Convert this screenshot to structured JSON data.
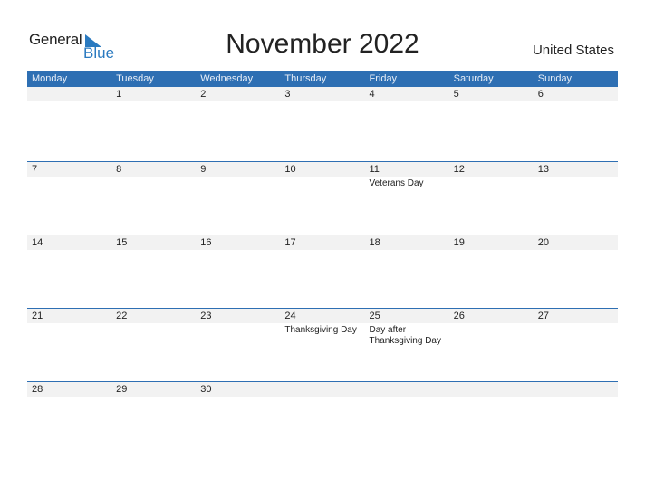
{
  "logo": {
    "general": "General",
    "blue": "Blue"
  },
  "title": "November 2022",
  "country": "United States",
  "weekdays": [
    "Monday",
    "Tuesday",
    "Wednesday",
    "Thursday",
    "Friday",
    "Saturday",
    "Sunday"
  ],
  "weeks": [
    {
      "days": [
        "",
        "1",
        "2",
        "3",
        "4",
        "5",
        "6"
      ],
      "events": [
        "",
        "",
        "",
        "",
        "",
        "",
        ""
      ]
    },
    {
      "days": [
        "7",
        "8",
        "9",
        "10",
        "11",
        "12",
        "13"
      ],
      "events": [
        "",
        "",
        "",
        "",
        "Veterans Day",
        "",
        ""
      ]
    },
    {
      "days": [
        "14",
        "15",
        "16",
        "17",
        "18",
        "19",
        "20"
      ],
      "events": [
        "",
        "",
        "",
        "",
        "",
        "",
        ""
      ]
    },
    {
      "days": [
        "21",
        "22",
        "23",
        "24",
        "25",
        "26",
        "27"
      ],
      "events": [
        "",
        "",
        "",
        "Thanksgiving Day",
        "Day after Thanksgiving Day",
        "",
        ""
      ]
    },
    {
      "days": [
        "28",
        "29",
        "30",
        "",
        "",
        "",
        ""
      ],
      "events": [
        "",
        "",
        "",
        "",
        "",
        "",
        ""
      ]
    }
  ],
  "colors": {
    "accent": "#2e6fb3",
    "strip": "#f2f2f2"
  }
}
